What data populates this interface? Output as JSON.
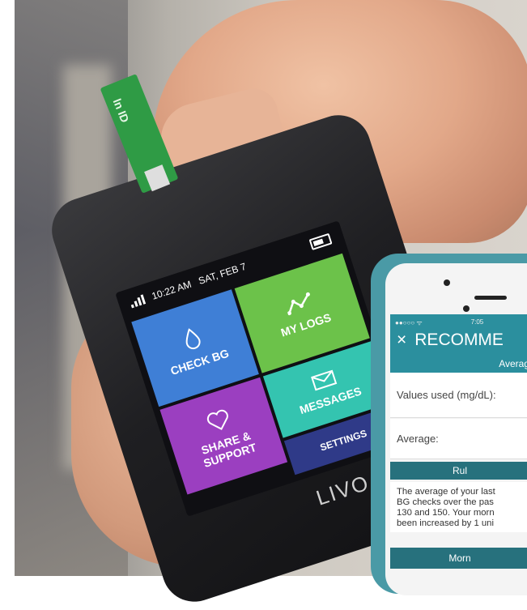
{
  "meter": {
    "time": "10:22 AM",
    "date": "SAT, FEB 7",
    "tiles": [
      {
        "label": "CHECK BG",
        "icon": "drop-icon"
      },
      {
        "label": "MY LOGS",
        "icon": "chart-icon"
      },
      {
        "label": "SHARE & SUPPORT",
        "icon": "heart-icon"
      },
      {
        "label": "MESSAGES",
        "icon": "envelope-icon"
      },
      {
        "label": "SETTINGS",
        "icon": ""
      }
    ],
    "brand": "LIVO",
    "strip_text": "ln ID"
  },
  "phone": {
    "status_time": "7:05",
    "title": "RECOMME",
    "close_glyph": "×",
    "average_bar": "Averag",
    "values_label": "Values used (mg/dL):",
    "average_label": "Average:",
    "rule_bar": "Rul",
    "paragraph_lines": [
      "The average of your last",
      "BG checks over the pas",
      "130 and 150. Your morn",
      "been increased by 1 uni"
    ],
    "morning_bar": "Morn"
  },
  "colors": {
    "teal": "#2b8f9e",
    "check_bg": "#3f7fd6",
    "logs": "#6cc24a",
    "share": "#9b3fc0",
    "messages": "#34c4b0",
    "settings": "#2f3a88"
  }
}
